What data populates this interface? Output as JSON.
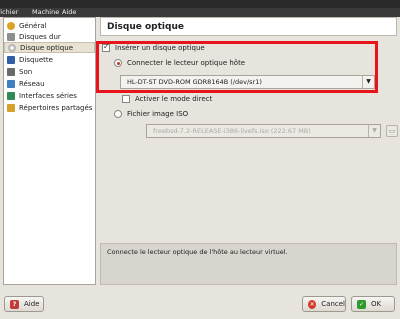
{
  "menu": {
    "file": "Fichier",
    "machine": "Machine",
    "help": "Aide"
  },
  "sidebar": {
    "items": [
      {
        "label": "Général",
        "icon": "gear-icon",
        "color": "#d9a326"
      },
      {
        "label": "Disques dur",
        "icon": "hard-disk-icon",
        "color": "#8e8e8e"
      },
      {
        "label": "Disque optique",
        "icon": "optical-disc-icon",
        "color": "#c8c8c8"
      },
      {
        "label": "Disquette",
        "icon": "floppy-icon",
        "color": "#2f5fa8"
      },
      {
        "label": "Son",
        "icon": "speaker-icon",
        "color": "#6a6a6a"
      },
      {
        "label": "Réseau",
        "icon": "network-icon",
        "color": "#3c7fc0"
      },
      {
        "label": "Interfaces séries",
        "icon": "serial-port-icon",
        "color": "#2e8b57"
      },
      {
        "label": "Répertoires partagés",
        "icon": "shared-folder-icon",
        "color": "#d4a12a"
      }
    ],
    "selected_index": 2
  },
  "header": {
    "title": "Disque optique"
  },
  "main": {
    "insert_disk": {
      "label": "Insérer un disque optique",
      "checked": true
    },
    "host_drive": {
      "label": "Connecter le lecteur optique hôte",
      "selected": true
    },
    "host_drive_combo": {
      "value": "HL-DT-ST DVD-ROM GDR8164B (/dev/sr1)"
    },
    "passthrough": {
      "label": "Activer le mode direct",
      "checked": false
    },
    "iso_file": {
      "label": "Fichier image ISO",
      "selected": false
    },
    "iso_combo": {
      "value": "freebsd-7.2-RELEASE-i386-livefs.iso (222.67 MB)"
    }
  },
  "description": "Connecte le lecteur optique de l'hôte au lecteur virtuel.",
  "buttons": {
    "help": "Aide",
    "cancel": "Cancel",
    "ok": "OK"
  },
  "colors": {
    "accent_highlight": "#e8141c",
    "ok_icon": "#2e9b2e",
    "cancel_icon": "#d33a2c",
    "help_icon": "#c23b3b"
  }
}
